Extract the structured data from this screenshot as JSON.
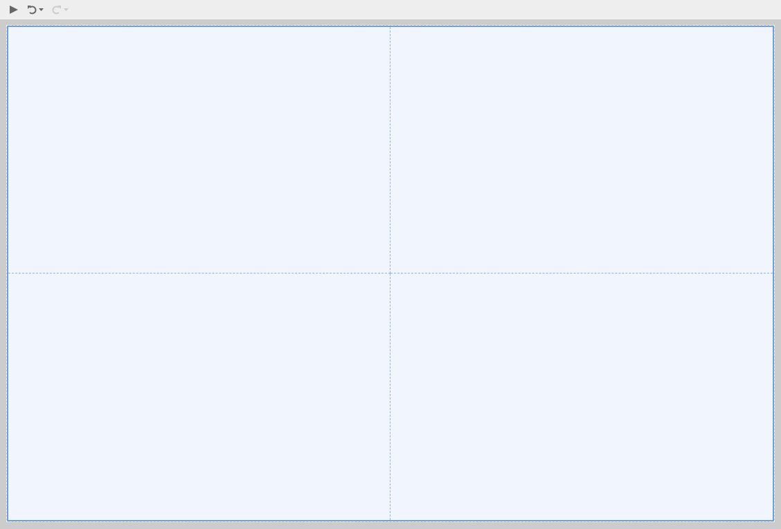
{
  "toolbar": {
    "buttons": [
      {
        "kind": "run",
        "disabled": false
      },
      {
        "kind": "undo",
        "disabled": false
      },
      {
        "kind": "redo",
        "disabled": true
      }
    ]
  }
}
